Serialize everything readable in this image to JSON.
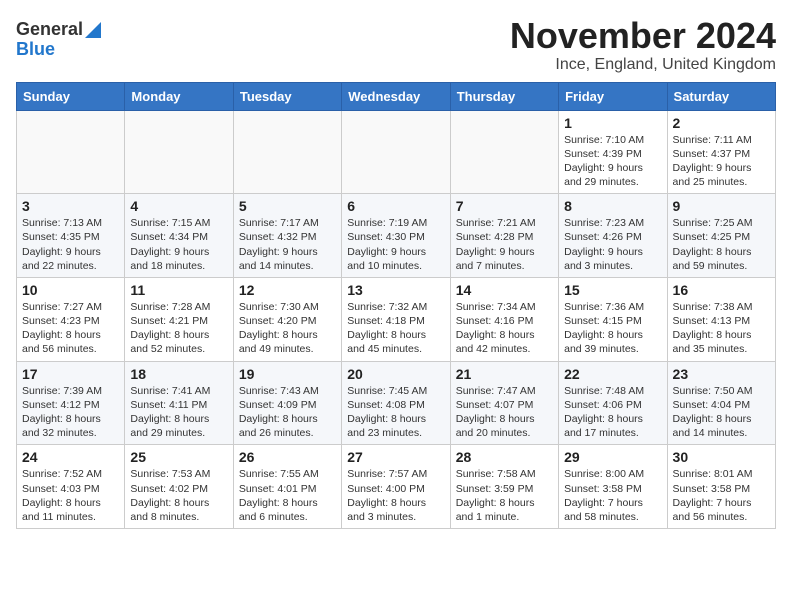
{
  "logo": {
    "general": "General",
    "blue": "Blue",
    "icon": "▶"
  },
  "title": "November 2024",
  "subtitle": "Ince, England, United Kingdom",
  "headers": [
    "Sunday",
    "Monday",
    "Tuesday",
    "Wednesday",
    "Thursday",
    "Friday",
    "Saturday"
  ],
  "weeks": [
    [
      {
        "day": "",
        "info": ""
      },
      {
        "day": "",
        "info": ""
      },
      {
        "day": "",
        "info": ""
      },
      {
        "day": "",
        "info": ""
      },
      {
        "day": "",
        "info": ""
      },
      {
        "day": "1",
        "info": "Sunrise: 7:10 AM\nSunset: 4:39 PM\nDaylight: 9 hours\nand 29 minutes."
      },
      {
        "day": "2",
        "info": "Sunrise: 7:11 AM\nSunset: 4:37 PM\nDaylight: 9 hours\nand 25 minutes."
      }
    ],
    [
      {
        "day": "3",
        "info": "Sunrise: 7:13 AM\nSunset: 4:35 PM\nDaylight: 9 hours\nand 22 minutes."
      },
      {
        "day": "4",
        "info": "Sunrise: 7:15 AM\nSunset: 4:34 PM\nDaylight: 9 hours\nand 18 minutes."
      },
      {
        "day": "5",
        "info": "Sunrise: 7:17 AM\nSunset: 4:32 PM\nDaylight: 9 hours\nand 14 minutes."
      },
      {
        "day": "6",
        "info": "Sunrise: 7:19 AM\nSunset: 4:30 PM\nDaylight: 9 hours\nand 10 minutes."
      },
      {
        "day": "7",
        "info": "Sunrise: 7:21 AM\nSunset: 4:28 PM\nDaylight: 9 hours\nand 7 minutes."
      },
      {
        "day": "8",
        "info": "Sunrise: 7:23 AM\nSunset: 4:26 PM\nDaylight: 9 hours\nand 3 minutes."
      },
      {
        "day": "9",
        "info": "Sunrise: 7:25 AM\nSunset: 4:25 PM\nDaylight: 8 hours\nand 59 minutes."
      }
    ],
    [
      {
        "day": "10",
        "info": "Sunrise: 7:27 AM\nSunset: 4:23 PM\nDaylight: 8 hours\nand 56 minutes."
      },
      {
        "day": "11",
        "info": "Sunrise: 7:28 AM\nSunset: 4:21 PM\nDaylight: 8 hours\nand 52 minutes."
      },
      {
        "day": "12",
        "info": "Sunrise: 7:30 AM\nSunset: 4:20 PM\nDaylight: 8 hours\nand 49 minutes."
      },
      {
        "day": "13",
        "info": "Sunrise: 7:32 AM\nSunset: 4:18 PM\nDaylight: 8 hours\nand 45 minutes."
      },
      {
        "day": "14",
        "info": "Sunrise: 7:34 AM\nSunset: 4:16 PM\nDaylight: 8 hours\nand 42 minutes."
      },
      {
        "day": "15",
        "info": "Sunrise: 7:36 AM\nSunset: 4:15 PM\nDaylight: 8 hours\nand 39 minutes."
      },
      {
        "day": "16",
        "info": "Sunrise: 7:38 AM\nSunset: 4:13 PM\nDaylight: 8 hours\nand 35 minutes."
      }
    ],
    [
      {
        "day": "17",
        "info": "Sunrise: 7:39 AM\nSunset: 4:12 PM\nDaylight: 8 hours\nand 32 minutes."
      },
      {
        "day": "18",
        "info": "Sunrise: 7:41 AM\nSunset: 4:11 PM\nDaylight: 8 hours\nand 29 minutes."
      },
      {
        "day": "19",
        "info": "Sunrise: 7:43 AM\nSunset: 4:09 PM\nDaylight: 8 hours\nand 26 minutes."
      },
      {
        "day": "20",
        "info": "Sunrise: 7:45 AM\nSunset: 4:08 PM\nDaylight: 8 hours\nand 23 minutes."
      },
      {
        "day": "21",
        "info": "Sunrise: 7:47 AM\nSunset: 4:07 PM\nDaylight: 8 hours\nand 20 minutes."
      },
      {
        "day": "22",
        "info": "Sunrise: 7:48 AM\nSunset: 4:06 PM\nDaylight: 8 hours\nand 17 minutes."
      },
      {
        "day": "23",
        "info": "Sunrise: 7:50 AM\nSunset: 4:04 PM\nDaylight: 8 hours\nand 14 minutes."
      }
    ],
    [
      {
        "day": "24",
        "info": "Sunrise: 7:52 AM\nSunset: 4:03 PM\nDaylight: 8 hours\nand 11 minutes."
      },
      {
        "day": "25",
        "info": "Sunrise: 7:53 AM\nSunset: 4:02 PM\nDaylight: 8 hours\nand 8 minutes."
      },
      {
        "day": "26",
        "info": "Sunrise: 7:55 AM\nSunset: 4:01 PM\nDaylight: 8 hours\nand 6 minutes."
      },
      {
        "day": "27",
        "info": "Sunrise: 7:57 AM\nSunset: 4:00 PM\nDaylight: 8 hours\nand 3 minutes."
      },
      {
        "day": "28",
        "info": "Sunrise: 7:58 AM\nSunset: 3:59 PM\nDaylight: 8 hours\nand 1 minute."
      },
      {
        "day": "29",
        "info": "Sunrise: 8:00 AM\nSunset: 3:58 PM\nDaylight: 7 hours\nand 58 minutes."
      },
      {
        "day": "30",
        "info": "Sunrise: 8:01 AM\nSunset: 3:58 PM\nDaylight: 7 hours\nand 56 minutes."
      }
    ]
  ]
}
